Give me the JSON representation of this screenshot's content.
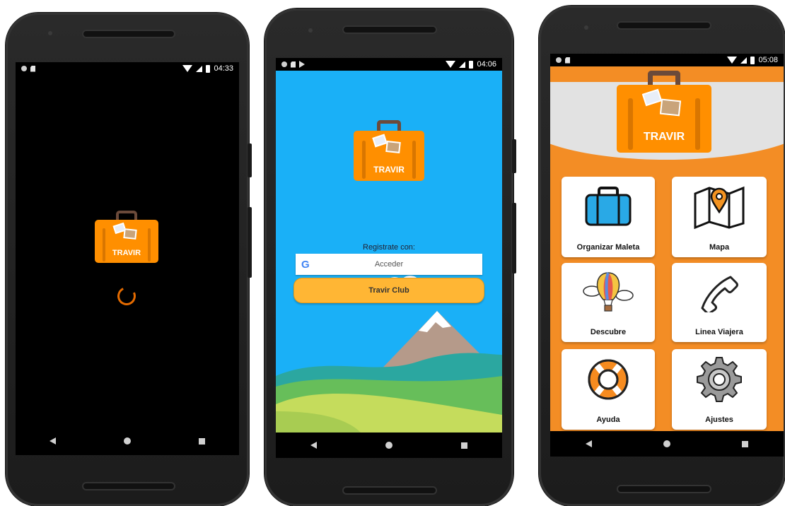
{
  "phone1": {
    "status": {
      "time": "04:33"
    },
    "logo_text": "TRAVIR"
  },
  "phone2": {
    "status": {
      "time": "04:06"
    },
    "logo_text": "TRAVIR",
    "register_label": "Registrate con:",
    "google_button": "Acceder",
    "club_button": "Travir Club"
  },
  "phone3": {
    "status": {
      "time": "05:08"
    },
    "logo_text": "TRAVIR",
    "tiles": [
      {
        "label": "Organizar Maleta",
        "icon": "suitcase-icon"
      },
      {
        "label": "Mapa",
        "icon": "map-pin-icon"
      },
      {
        "label": "Descubre",
        "icon": "hot-air-balloon-icon"
      },
      {
        "label": "Linea Viajera",
        "icon": "phone-handset-icon"
      },
      {
        "label": "Ayuda",
        "icon": "lifebuoy-icon"
      },
      {
        "label": "Ajustes",
        "icon": "gear-icon"
      }
    ]
  },
  "colors": {
    "brand_orange": "#ff8f00",
    "sky_blue": "#1ab0f7",
    "menu_orange": "#f38d25",
    "club_yellow": "#ffb634"
  }
}
